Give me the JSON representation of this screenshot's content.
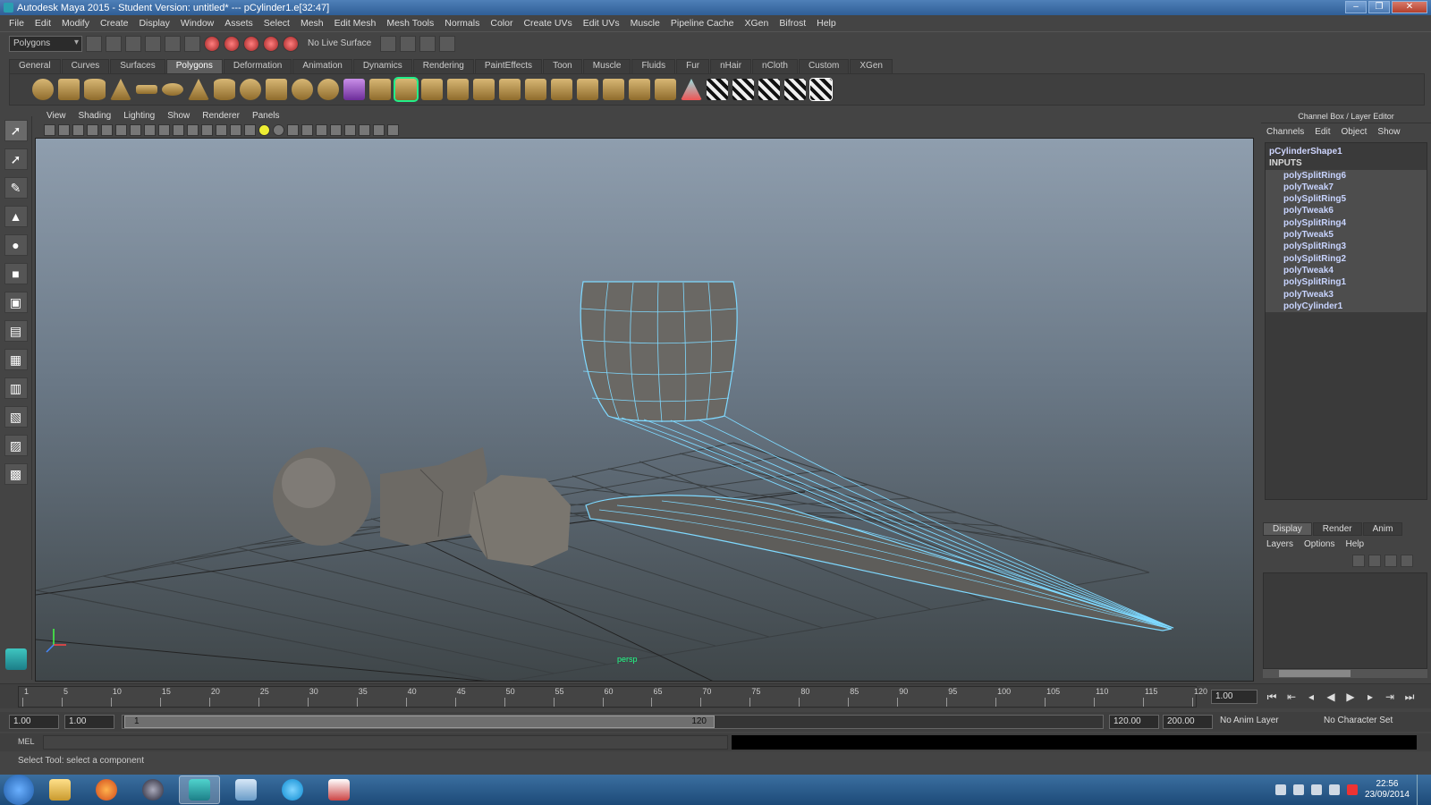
{
  "window": {
    "title": "Autodesk Maya 2015 - Student Version: untitled*  ---  pCylinder1.e[32:47]",
    "controls": [
      "–",
      "❐",
      "✕"
    ]
  },
  "menubar": {
    "items": [
      "File",
      "Edit",
      "Modify",
      "Create",
      "Display",
      "Window",
      "Assets",
      "Select",
      "Mesh",
      "Edit Mesh",
      "Mesh Tools",
      "Normals",
      "Color",
      "Create UVs",
      "Edit UVs",
      "Muscle",
      "Pipeline Cache",
      "XGen",
      "Bifrost",
      "Help"
    ]
  },
  "statusline": {
    "mode": "Polygons",
    "live_surface": "No Live Surface"
  },
  "shelf": {
    "tabs": [
      "General",
      "Curves",
      "Surfaces",
      "Polygons",
      "Deformation",
      "Animation",
      "Dynamics",
      "Rendering",
      "PaintEffects",
      "Toon",
      "Muscle",
      "Fluids",
      "Fur",
      "nHair",
      "nCloth",
      "Custom",
      "XGen"
    ],
    "active_tab": "Polygons"
  },
  "viewport": {
    "menu": [
      "View",
      "Shading",
      "Lighting",
      "Show",
      "Renderer",
      "Panels"
    ],
    "camera_label": "persp",
    "axis": {
      "x": "x",
      "y": "y",
      "z": "z"
    }
  },
  "channel_box": {
    "title": "Channel Box / Layer Editor",
    "menu": [
      "Channels",
      "Edit",
      "Object",
      "Show"
    ],
    "shape": "pCylinderShape1",
    "inputs_label": "INPUTS",
    "inputs": [
      "polySplitRing6",
      "polyTweak7",
      "polySplitRing5",
      "polyTweak6",
      "polySplitRing4",
      "polyTweak5",
      "polySplitRing3",
      "polySplitRing2",
      "polyTweak4",
      "polySplitRing1",
      "polyTweak3",
      "polyCylinder1"
    ]
  },
  "layer_editor": {
    "tabs": [
      "Display",
      "Render",
      "Anim"
    ],
    "active_tab": "Display",
    "menu": [
      "Layers",
      "Options",
      "Help"
    ]
  },
  "timeline": {
    "ticks": [
      "1",
      "5",
      "10",
      "15",
      "20",
      "25",
      "30",
      "35",
      "40",
      "45",
      "50",
      "55",
      "60",
      "65",
      "70",
      "75",
      "80",
      "85",
      "90",
      "95",
      "100",
      "105",
      "110",
      "115",
      "120"
    ],
    "current_frame": "1.00"
  },
  "range": {
    "start": "1.00",
    "inner_start": "1.00",
    "handle_start": "1",
    "handle_end": "120",
    "end": "120.00",
    "anim_end": "200.00",
    "anim_layer": "No Anim Layer",
    "character_set": "No Character Set"
  },
  "command_line": {
    "label": "MEL"
  },
  "help_line": {
    "text": "Select Tool: select a component"
  },
  "taskbar": {
    "time": "22:56",
    "date": "23/09/2014"
  },
  "colors": {
    "ui_bg": "#444444",
    "viewport_top": "#8f9eae",
    "viewport_bottom": "#3f4649",
    "wire_highlight": "#7fd9ff",
    "mesh_gray": "#6e6b66"
  }
}
